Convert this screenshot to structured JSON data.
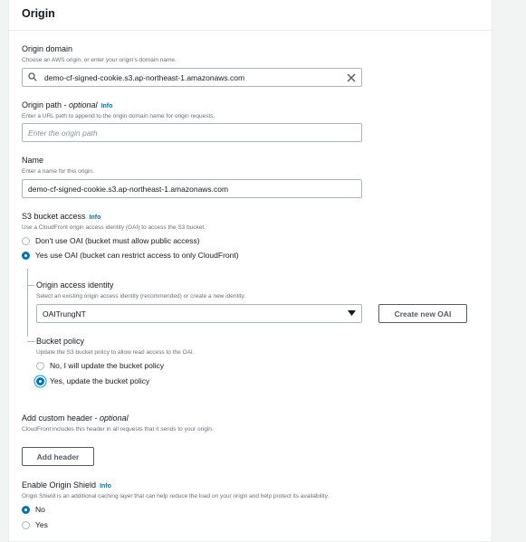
{
  "section": {
    "title": "Origin"
  },
  "origin_domain": {
    "label": "Origin domain",
    "description": "Choose an AWS origin, or enter your origin's domain name.",
    "value": "demo-cf-signed-cookie.s3.ap-northeast-1.amazonaws.com"
  },
  "origin_path": {
    "label": "Origin path - ",
    "optional": "optional",
    "info": "Info",
    "description": "Enter a URL path to append to the origin domain name for origin requests.",
    "placeholder": "Enter the origin path"
  },
  "name": {
    "label": "Name",
    "description": "Enter a name for this origin.",
    "value": "demo-cf-signed-cookie.s3.ap-northeast-1.amazonaws.com"
  },
  "s3_access": {
    "label": "S3 bucket access",
    "info": "Info",
    "description": "Use a CloudFront origin access identity (OAI) to access the S3 bucket.",
    "options": [
      {
        "label": "Don't use OAI (bucket must allow public access)",
        "selected": false
      },
      {
        "label": "Yes use OAI (bucket can restrict access to only CloudFront)",
        "selected": true
      }
    ]
  },
  "oai": {
    "label": "Origin access identity",
    "description": "Select an existing origin access identity (recommended) or create a new identity.",
    "selected": "OAITrungNT",
    "create_button": "Create new OAI"
  },
  "bucket_policy": {
    "label": "Bucket policy",
    "description": "Update the S3 bucket policy to allow read access to the OAI.",
    "options": [
      {
        "label": "No, I will update the bucket policy",
        "selected": false
      },
      {
        "label": "Yes, update the bucket policy",
        "selected": true
      }
    ]
  },
  "custom_header": {
    "label": "Add custom header - ",
    "optional": "optional",
    "description": "CloudFront includes this header in all requests that it sends to your origin.",
    "button": "Add header"
  },
  "origin_shield": {
    "label": "Enable Origin Shield",
    "info": "Info",
    "description": "Origin Shield is an additional caching layer that can help reduce the load on your origin and help protect its availability.",
    "options": [
      {
        "label": "No",
        "selected": true
      },
      {
        "label": "Yes",
        "selected": false
      }
    ]
  },
  "icons": {
    "search": "search-icon",
    "clear": "close-icon",
    "dropdown": "caret-down-icon"
  },
  "colors": {
    "accent": "#0073bb",
    "link": "#0073bb",
    "border": "#aab7b8",
    "text": "#16191f",
    "muted": "#687078"
  }
}
